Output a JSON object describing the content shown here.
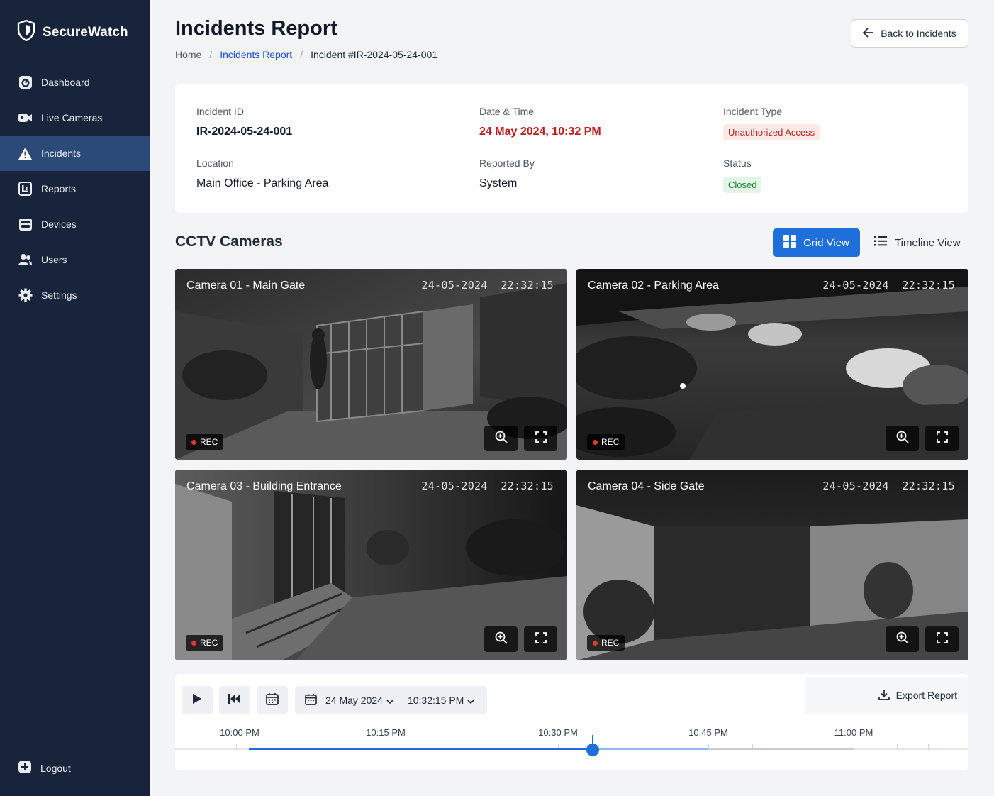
{
  "brand": {
    "name": "SecureWatch",
    "icon": "shield-icon"
  },
  "sidebar": {
    "items": [
      {
        "label": "Dashboard",
        "icon": "dashboard-icon",
        "active": false
      },
      {
        "label": "Live Cameras",
        "icon": "video-camera-icon",
        "active": false
      },
      {
        "label": "Incidents",
        "icon": "warning-icon",
        "active": true
      },
      {
        "label": "Reports",
        "icon": "report-icon",
        "active": false
      },
      {
        "label": "Devices",
        "icon": "devices-icon",
        "active": false
      },
      {
        "label": "Users",
        "icon": "users-icon",
        "active": false
      },
      {
        "label": "Settings",
        "icon": "gear-icon",
        "active": false
      }
    ],
    "logout": "Logout"
  },
  "header": {
    "title": "Incidents Report",
    "back_label": "Back to Incidents",
    "breadcrumb": {
      "home": "Home",
      "parent": "Incidents Report",
      "current": "Incident #IR-2024-05-24-001"
    }
  },
  "incident": {
    "id_label": "Incident ID",
    "id_value": "IR-2024-05-24-001",
    "datetime_label": "Date & Time",
    "datetime_value": "24 May 2024, 10:32 PM",
    "type_label": "Incident Type",
    "type_value": "Unauthorized Access",
    "location_label": "Location",
    "location_value": "Main Office - Parking Area",
    "reported_label": "Reported By",
    "reported_value": "System",
    "status_label": "Status",
    "status_value": "Closed"
  },
  "cameras_section": {
    "title": "CCTV Cameras",
    "grid_label": "Grid View",
    "timeline_label": "Timeline View",
    "rec_label": "REC",
    "cameras": [
      {
        "name": "Camera 01 - Main Gate",
        "timestamp": "24-05-2024  22:32:15"
      },
      {
        "name": "Camera 02 - Parking Area",
        "timestamp": "24-05-2024  22:32:15"
      },
      {
        "name": "Camera 03 - Building Entrance",
        "timestamp": "24-05-2024  22:32:15"
      },
      {
        "name": "Camera 04 - Side Gate",
        "timestamp": "24-05-2024  22:32:15"
      }
    ]
  },
  "player": {
    "date": "24 May 2024",
    "time": "10:32:15 PM",
    "export_label": "Export Report",
    "timeline_labels": [
      "10:00 PM",
      "10:15 PM",
      "10:30 PM",
      "10:45 PM",
      "11:00 PM"
    ],
    "playhead_time": "10:32:15 PM"
  },
  "colors": {
    "sidebar": "#17243a",
    "sidebar_active": "#2c4a78",
    "accent": "#1e6fd9",
    "danger": "#b91c1c",
    "success": "#1e7b34"
  }
}
